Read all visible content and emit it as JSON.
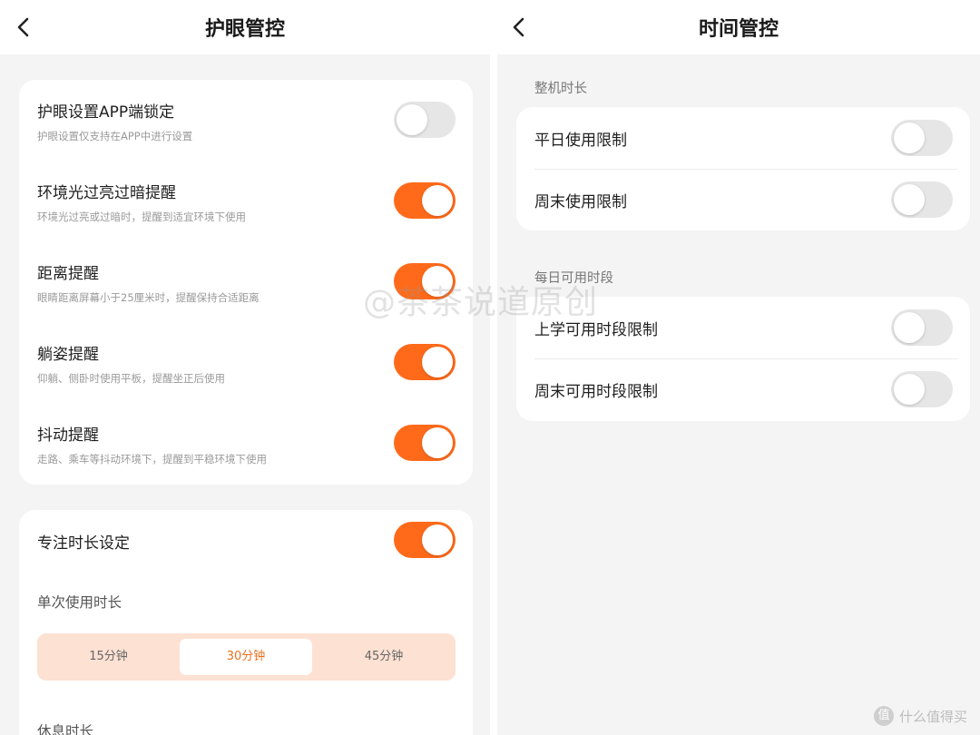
{
  "left": {
    "title": "护眼管控",
    "eye_card": {
      "items": [
        {
          "label": "护眼设置APP端锁定",
          "desc": "护眼设置仅支持在APP中进行设置",
          "on": false
        },
        {
          "label": "环境光过亮过暗提醒",
          "desc": "环境光过亮或过暗时，提醒到适宜环境下使用",
          "on": true
        },
        {
          "label": "距离提醒",
          "desc": "眼睛距离屏幕小于25厘米时，提醒保持合适距离",
          "on": true
        },
        {
          "label": "躺姿提醒",
          "desc": "仰躺、侧卧时使用平板，提醒坐正后使用",
          "on": true
        },
        {
          "label": "抖动提醒",
          "desc": "走路、乘车等抖动环境下，提醒到平稳环境下使用",
          "on": true
        }
      ]
    },
    "focus_card": {
      "label": "专注时长设定",
      "on": true,
      "single_label": "单次使用时长",
      "options": [
        "15分钟",
        "30分钟",
        "45分钟"
      ],
      "selected": "30分钟",
      "rest_label": "休息时长"
    }
  },
  "right": {
    "title": "时间管控",
    "section1": {
      "label": "整机时长",
      "items": [
        {
          "label": "平日使用限制",
          "on": false
        },
        {
          "label": "周末使用限制",
          "on": false
        }
      ]
    },
    "section2": {
      "label": "每日可用时段",
      "items": [
        {
          "label": "上学可用时段限制",
          "on": false
        },
        {
          "label": "周末可用时段限制",
          "on": false
        }
      ]
    }
  },
  "watermark": "@茶茶说道原创",
  "brand": {
    "logo_glyph": "值",
    "text": "什么值得买"
  },
  "colors": {
    "accent": "#ff6a1a",
    "segment_bg": "#fde1d3",
    "selected_text": "#e8701f",
    "toggle_off": "#e6e6e6"
  },
  "icons": {
    "back": "chevron-left-icon"
  }
}
